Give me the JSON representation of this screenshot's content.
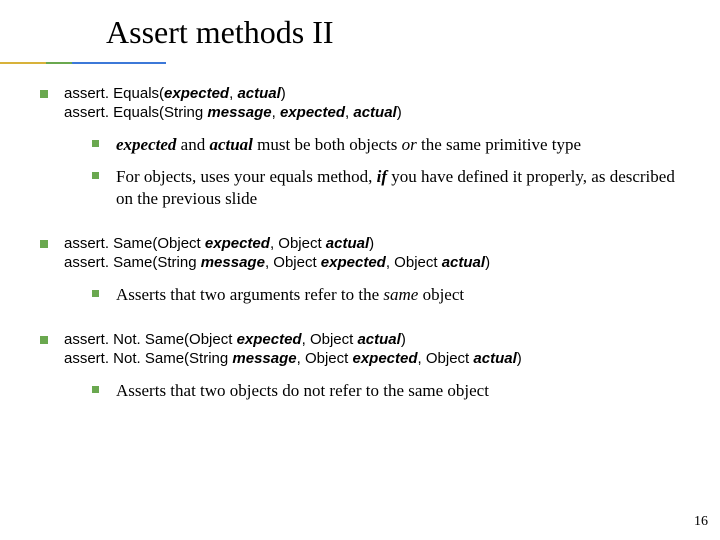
{
  "title": "Assert methods II",
  "b1": {
    "line1a": "assert. Equals(",
    "line1b": "expected",
    "line1c": ", ",
    "line1d": "actual",
    "line1e": ")",
    "line2a": "assert. Equals(String ",
    "line2b": "message",
    "line2c": ", ",
    "line2d": "expected",
    "line2e": ", ",
    "line2f": "actual",
    "line2g": ")",
    "s1a": "expected",
    "s1b": " and ",
    "s1c": "actual",
    "s1d": " must be both objects ",
    "s1e": "or",
    "s1f": " the same primitive type",
    "s2a": "For objects, uses your equals method, ",
    "s2b": "if",
    "s2c": " you have defined it properly, as described on the previous slide"
  },
  "b2": {
    "line1a": "assert. Same(Object ",
    "line1b": "expected",
    "line1c": ", Object ",
    "line1d": "actual",
    "line1e": ")",
    "line2a": "assert. Same(String ",
    "line2b": "message",
    "line2c": ", Object ",
    "line2d": "expected",
    "line2e": ", Object ",
    "line2f": "actual",
    "line2g": ")",
    "s1a": "Asserts that two arguments refer to the ",
    "s1b": "same",
    "s1c": " object"
  },
  "b3": {
    "line1a": "assert. Not. Same(Object ",
    "line1b": "expected",
    "line1c": ", Object ",
    "line1d": "actual",
    "line1e": ")",
    "line2a": "assert. Not. Same(String ",
    "line2b": "message",
    "line2c": ", Object ",
    "line2d": "expected",
    "line2e": ", Object ",
    "line2f": "actual",
    "line2g": ")",
    "s1": "Asserts that two objects do not refer to the same object"
  },
  "pagenum": "16"
}
